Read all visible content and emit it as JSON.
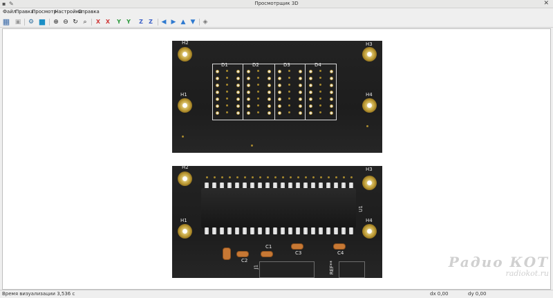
{
  "window": {
    "title": "Просмотрщик 3D",
    "close_glyph": "✕"
  },
  "menu": {
    "items": [
      "Файл",
      "Правка",
      "Просмотр",
      "Настройки",
      "Справка"
    ]
  },
  "toolbar": {
    "buttons": [
      {
        "name": "render-mode-icon",
        "glyph": "▦",
        "color": "#3b6aa8"
      },
      {
        "name": "copy-image-icon",
        "glyph": "▣",
        "color": "#9a9a9a"
      },
      {
        "name": "settings-icon",
        "glyph": "⚙",
        "color": "#2b6b9b"
      },
      {
        "name": "raytracing-icon",
        "glyph": "■",
        "color": "#1b8fc6"
      },
      {
        "name": "zoom-in-icon",
        "glyph": "⊕",
        "color": "#333333"
      },
      {
        "name": "zoom-out-icon",
        "glyph": "⊖",
        "color": "#333333"
      },
      {
        "name": "redraw-icon",
        "glyph": "↻",
        "color": "#333333"
      },
      {
        "name": "zoom-fit-icon",
        "glyph": "⌕",
        "color": "#333333"
      },
      {
        "name": "rotate-x-cw-icon",
        "glyph": "X",
        "color": "#d03a3a"
      },
      {
        "name": "rotate-x-ccw-icon",
        "glyph": "X",
        "color": "#d03a3a"
      },
      {
        "name": "rotate-y-cw-icon",
        "glyph": "Y",
        "color": "#2c9a3c"
      },
      {
        "name": "rotate-y-ccw-icon",
        "glyph": "Y",
        "color": "#2c9a3c"
      },
      {
        "name": "rotate-z-cw-icon",
        "glyph": "Z",
        "color": "#3a5fc8"
      },
      {
        "name": "rotate-z-ccw-icon",
        "glyph": "Z",
        "color": "#3a5fc8"
      },
      {
        "name": "move-left-icon",
        "glyph": "◀",
        "color": "#2f7ad0"
      },
      {
        "name": "move-right-icon",
        "glyph": "▶",
        "color": "#2f7ad0"
      },
      {
        "name": "move-up-icon",
        "glyph": "▲",
        "color": "#2f7ad0"
      },
      {
        "name": "move-down-icon",
        "glyph": "▼",
        "color": "#2f7ad0"
      },
      {
        "name": "orthographic-icon",
        "glyph": "◈",
        "color": "#777777"
      }
    ]
  },
  "board_top": {
    "holes": [
      "H2",
      "H3",
      "H1",
      "H4"
    ],
    "components": [
      "D1",
      "D2",
      "D3",
      "D4"
    ]
  },
  "board_bottom": {
    "holes": [
      "H2",
      "H3",
      "H1",
      "H4"
    ],
    "ic": "U1",
    "caps": [
      "C1",
      "C2",
      "C3",
      "C4"
    ],
    "connectors": [
      "J1",
      "REF**"
    ]
  },
  "watermark": {
    "line1": "Радио КОТ",
    "line2": "radiokot.ru"
  },
  "status": {
    "render_time": "Время визуализации 3,536 с",
    "dx": "dx 0,00",
    "dy": "dy 0,00"
  }
}
